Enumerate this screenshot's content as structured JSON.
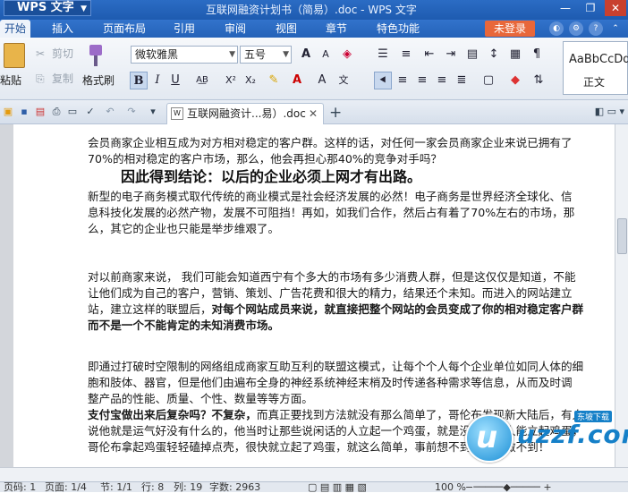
{
  "titlebar": {
    "app_name": "WPS 文字",
    "document_title": "互联网融资计划书（简易）.doc - WPS 文字",
    "minimize": "—",
    "maximize": "❐",
    "close": "✕"
  },
  "menu": {
    "tabs": [
      "开始",
      "插入",
      "页面布局",
      "引用",
      "审阅",
      "视图",
      "章节",
      "特色功能"
    ],
    "active_tab": "开始",
    "login_label": "未登录"
  },
  "ribbon": {
    "paste_label": "粘贴",
    "cut_label": "剪切",
    "copy_label": "复制",
    "format_painter_label": "格式刷",
    "font_name": "微软雅黑",
    "font_size": "五号",
    "style_preview": "AaBbCcDd",
    "style_name": "正文"
  },
  "doc_tab": {
    "label": "互联网融资计...易）.doc",
    "close": "✕"
  },
  "document": {
    "lines": [
      "会员商家企业相互成为对方相对稳定的客户群。这样的话，对任何一家会员商家企业来说已拥有了",
      "70%的相对稳定的客户市场，那么，他会再担心那40%的竞争对手吗？",
      "    新型的电子商务模式取代传统的商业模式是社会经济发展的必然！电子商务是世界经济全球化、信",
      "息科技化发展的必然产物，发展不可阻挡！再如，如我们合作，然后占有着了70%左右的市场，那",
      "么，其它的企业也只能是举步维艰了。",
      "    对以前商家来说， 我们可能会知道西宁有个多大的市场有多少消费人群，但是这仅仅是知道，不能",
      "让他们成为自己的客户，营销、策划、广告花费和很大的精力，结果还个未知。而进入的网站建立",
      "站，建立这样的联盟后，",
      "对每个网站成员来说，就直接把整个网站的会员变成了你的相对稳定客户群",
      "而不是一个不能肯定的未知消费市场。",
      "    即通过打破时空限制的网络组成商家互助互利的联盟这模式，让每个个人每个企业单位如同人体的细",
      "胞和肢体、器官，但是他们由遍布全身的神经系统神经末梢及时传递各种需求等信息，从而及时调",
      "整产品的性能、质量、个性、数量等等方面。",
      "支付宝做出来后复杂吗？不复杂，",
      "而真正要找到方法就没有那么简单了，哥伦布发现新大陆后，有人",
      "说他就是运气好没有什么的，他当时让那些说闲话的人立起一个鸡蛋，就是没有一个人能立起鸡蛋，",
      "哥伦布拿起鸡蛋轻轻磕掉点壳，很快就立起了鸡蛋，就这么简单，事前想不到，就是做不到！"
    ],
    "heading": "因此得到结论：以后的企业必须上网才有出路。"
  },
  "status": {
    "page_num": "页码: 1",
    "pages": "页面: 1/4",
    "section": "节: 1/1",
    "row": "行: 8",
    "col": "列: 19",
    "word_count": "字数: 2963",
    "zoom": "100 %"
  },
  "watermark": {
    "text": "uzzf.com",
    "sub": "东坡下载"
  }
}
